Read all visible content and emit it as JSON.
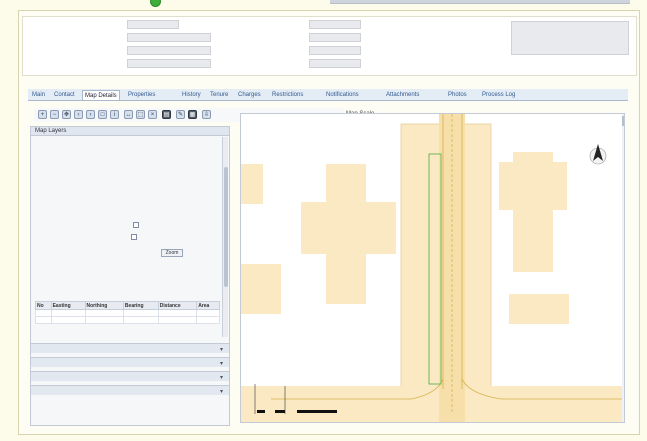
{
  "colors": {
    "map_parcel": "#fbe9c4",
    "map_parcel_border": "#e7cf99",
    "road_line": "#d6b24a",
    "link": "#2a3fb0",
    "accent_green": "#3fae3a"
  },
  "header": {
    "fields": [
      {
        "label": "",
        "value": ""
      },
      {
        "label": "",
        "value": ""
      },
      {
        "label": "",
        "value": ""
      },
      {
        "label": "",
        "value": ""
      },
      {
        "label": "",
        "value": ""
      },
      {
        "label": "",
        "value": ""
      },
      {
        "label": "",
        "value": ""
      },
      {
        "label": "",
        "value": ""
      }
    ],
    "notes_label": "",
    "notes_value": ""
  },
  "tabs": [
    {
      "label": "Main"
    },
    {
      "label": "Contact"
    },
    {
      "label": "Map Details"
    },
    {
      "label": "Properties"
    },
    {
      "label": "History"
    },
    {
      "label": "Tenure"
    },
    {
      "label": "Charges"
    },
    {
      "label": "Restrictions"
    },
    {
      "label": "Notifications"
    },
    {
      "label": "Attachments"
    },
    {
      "label": "Photos"
    },
    {
      "label": "Process Log"
    }
  ],
  "toolbar": {
    "zoom_label": "Map Scale"
  },
  "sidebar": {
    "title": "Map Layers",
    "links": [
      "",
      "",
      "",
      "",
      "",
      ""
    ],
    "options": [
      "",
      "",
      ""
    ],
    "zoom_button": "Zoom",
    "green_note": "",
    "table_headers": [
      "No",
      "Easting",
      "Northing",
      "Bearing",
      "Distance",
      "Area"
    ],
    "table_rows": [
      [
        "",
        "",
        "",
        "",
        "",
        ""
      ],
      [
        "",
        "",
        "",
        "",
        "",
        ""
      ]
    ],
    "sections": [
      "",
      "",
      "",
      ""
    ]
  },
  "map": {
    "north_label": "N"
  }
}
